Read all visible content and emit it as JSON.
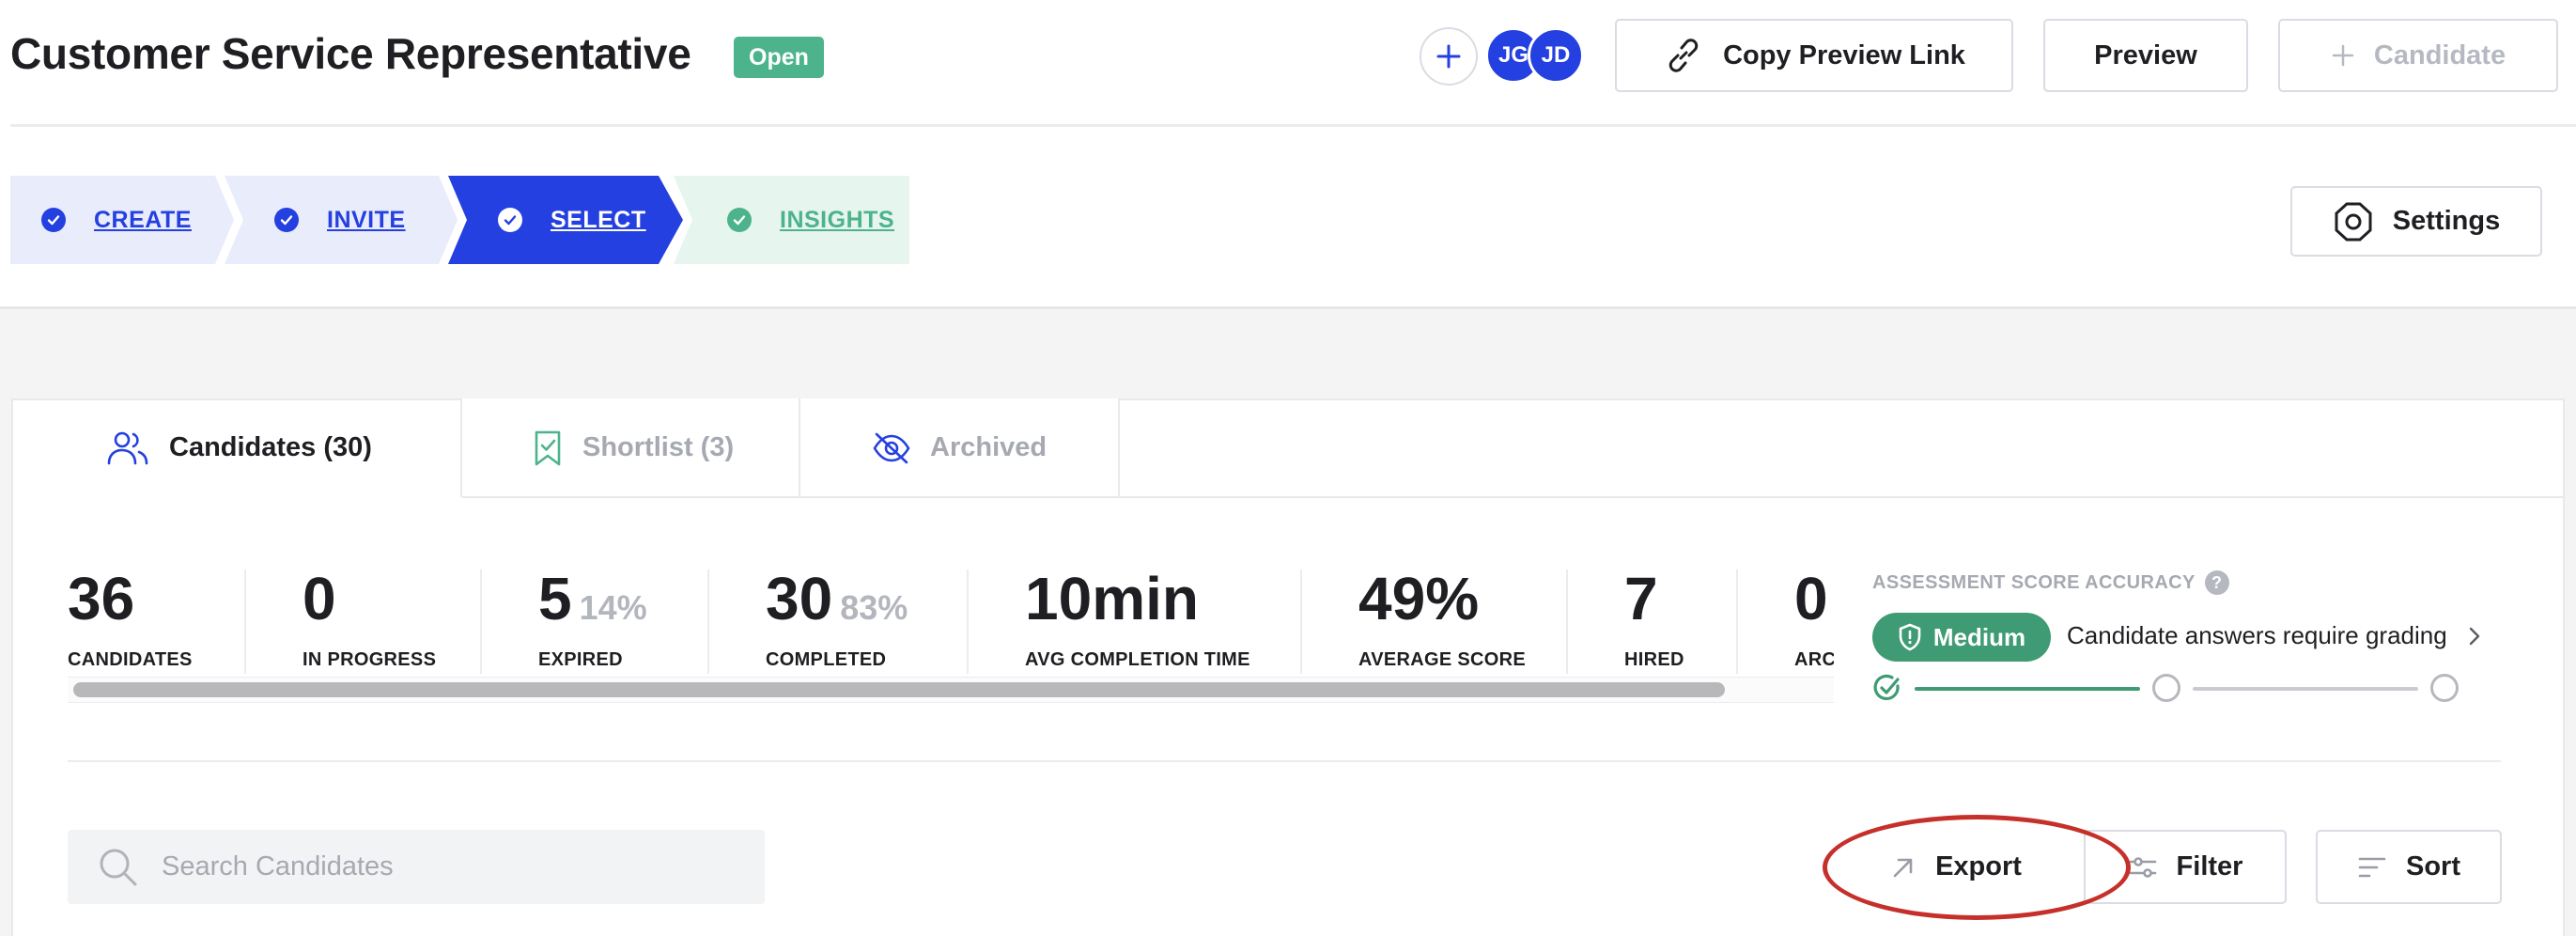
{
  "header": {
    "title": "Customer Service Representative",
    "status": "Open",
    "avatars": [
      "JG",
      "JD"
    ],
    "copy_link_label": "Copy Preview Link",
    "preview_label": "Preview",
    "candidate_label": "Candidate"
  },
  "steps": [
    {
      "label": "CREATE",
      "state": "done"
    },
    {
      "label": "INVITE",
      "state": "done"
    },
    {
      "label": "SELECT",
      "state": "active"
    },
    {
      "label": "INSIGHTS",
      "state": "upcoming"
    }
  ],
  "settings_label": "Settings",
  "tabs": [
    {
      "label": "Candidates (30)",
      "icon": "users-icon",
      "active": true
    },
    {
      "label": "Shortlist (3)",
      "icon": "bookmark-check-icon",
      "active": false
    },
    {
      "label": "Archived",
      "icon": "eye-off-icon",
      "active": false
    }
  ],
  "stats": [
    {
      "value": "36",
      "pct": "",
      "label": "CANDIDATES"
    },
    {
      "value": "0",
      "pct": "",
      "label": "IN PROGRESS"
    },
    {
      "value": "5",
      "pct": "14%",
      "label": "EXPIRED"
    },
    {
      "value": "30",
      "pct": "83%",
      "label": "COMPLETED"
    },
    {
      "value": "10min",
      "pct": "",
      "label": "AVG COMPLETION TIME"
    },
    {
      "value": "49%",
      "pct": "",
      "label": "AVERAGE SCORE"
    },
    {
      "value": "7",
      "pct": "",
      "label": "HIRED"
    },
    {
      "value": "0",
      "pct": "",
      "label": "ARC"
    }
  ],
  "accuracy": {
    "heading": "ASSESSMENT SCORE ACCURACY",
    "help": "?",
    "level": "Medium",
    "description": "Candidate answers require grading",
    "progress_steps_completed": 1,
    "progress_steps_total": 3
  },
  "toolbar": {
    "search_placeholder": "Search Candidates",
    "export_label": "Export",
    "filter_label": "Filter",
    "sort_label": "Sort"
  },
  "colors": {
    "brand_blue": "#2540e0",
    "status_green": "#4cb38d",
    "accuracy_green": "#3f9b73",
    "annotation_red": "#c6302b"
  }
}
